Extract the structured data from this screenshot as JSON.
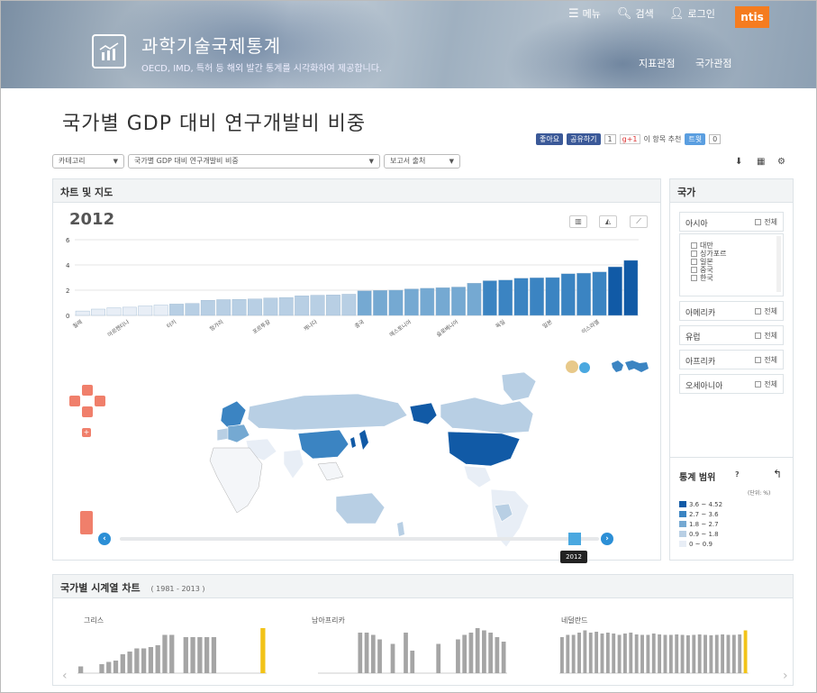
{
  "header": {
    "brand_title": "과학기술국제통계",
    "brand_sub": "OECD, IMD, 특허 등 해외 발간 통계를 시각화하여 제공합니다.",
    "menu_label": "메뉴",
    "search_label": "검색",
    "login_label": "로그인",
    "corner_logo": "ntis",
    "subnav": [
      "지표관점",
      "국가관점"
    ]
  },
  "page": {
    "title": "국가별 GDP 대비 연구개발비 비중"
  },
  "share": {
    "like": "좋아요",
    "share": "공유하기",
    "share_count": "1",
    "gplus": "g+1",
    "gplus_text": "이 항목 추천",
    "tweet": "트윗",
    "tweet_count": "0"
  },
  "filters": {
    "category": "카테고리",
    "indicator": "국가별 GDP 대비 연구개발비 비중",
    "source": "보고서 출처"
  },
  "chart_panel": {
    "title": "차트 및 지도",
    "year": "2012",
    "slider_year": "2012"
  },
  "chart_data": {
    "type": "bar",
    "year": "2012",
    "ylim": [
      0,
      6
    ],
    "yticks": [
      0,
      2,
      4,
      6
    ],
    "xtick_labels": [
      "칠레",
      "아르헨티나",
      "터키",
      "헝가리",
      "포르투갈",
      "캐나다",
      "중국",
      "에스토니아",
      "슬로베니아",
      "독일",
      "일본",
      "이스라엘"
    ],
    "values": [
      0.35,
      0.5,
      0.6,
      0.65,
      0.75,
      0.82,
      0.9,
      0.95,
      1.2,
      1.25,
      1.27,
      1.3,
      1.38,
      1.42,
      1.55,
      1.6,
      1.62,
      1.68,
      1.95,
      1.98,
      2.0,
      2.1,
      2.15,
      2.2,
      2.25,
      2.55,
      2.75,
      2.8,
      2.95,
      2.98,
      3.0,
      3.3,
      3.35,
      3.45,
      3.85,
      4.36
    ],
    "colors": {
      "bin0": "#e8eef6",
      "bin1": "#b8cfe4",
      "bin2": "#75a9d2",
      "bin3": "#3b84c2",
      "bin4": "#115aa6"
    }
  },
  "country_panel": {
    "title": "국가",
    "all_label": "전체",
    "regions": [
      "아시아",
      "아메리카",
      "유럽",
      "아프리카",
      "오세아니아"
    ],
    "asia_countries": [
      "대만",
      "싱가포르",
      "일본",
      "중국",
      "한국"
    ]
  },
  "legend": {
    "title": "통계 범위",
    "unit": "(단위: %)",
    "items": [
      "3.6 ~ 4.52",
      "2.7 ~ 3.6",
      "1.8 ~ 2.7",
      "0.9 ~ 1.8",
      "0 ~ 0.9"
    ]
  },
  "timeseries": {
    "title": "국가별 시계열 차트",
    "range": "( 1981 - 2013 )",
    "countries": [
      "그리스",
      "남아프리카",
      "네덜란드"
    ]
  }
}
